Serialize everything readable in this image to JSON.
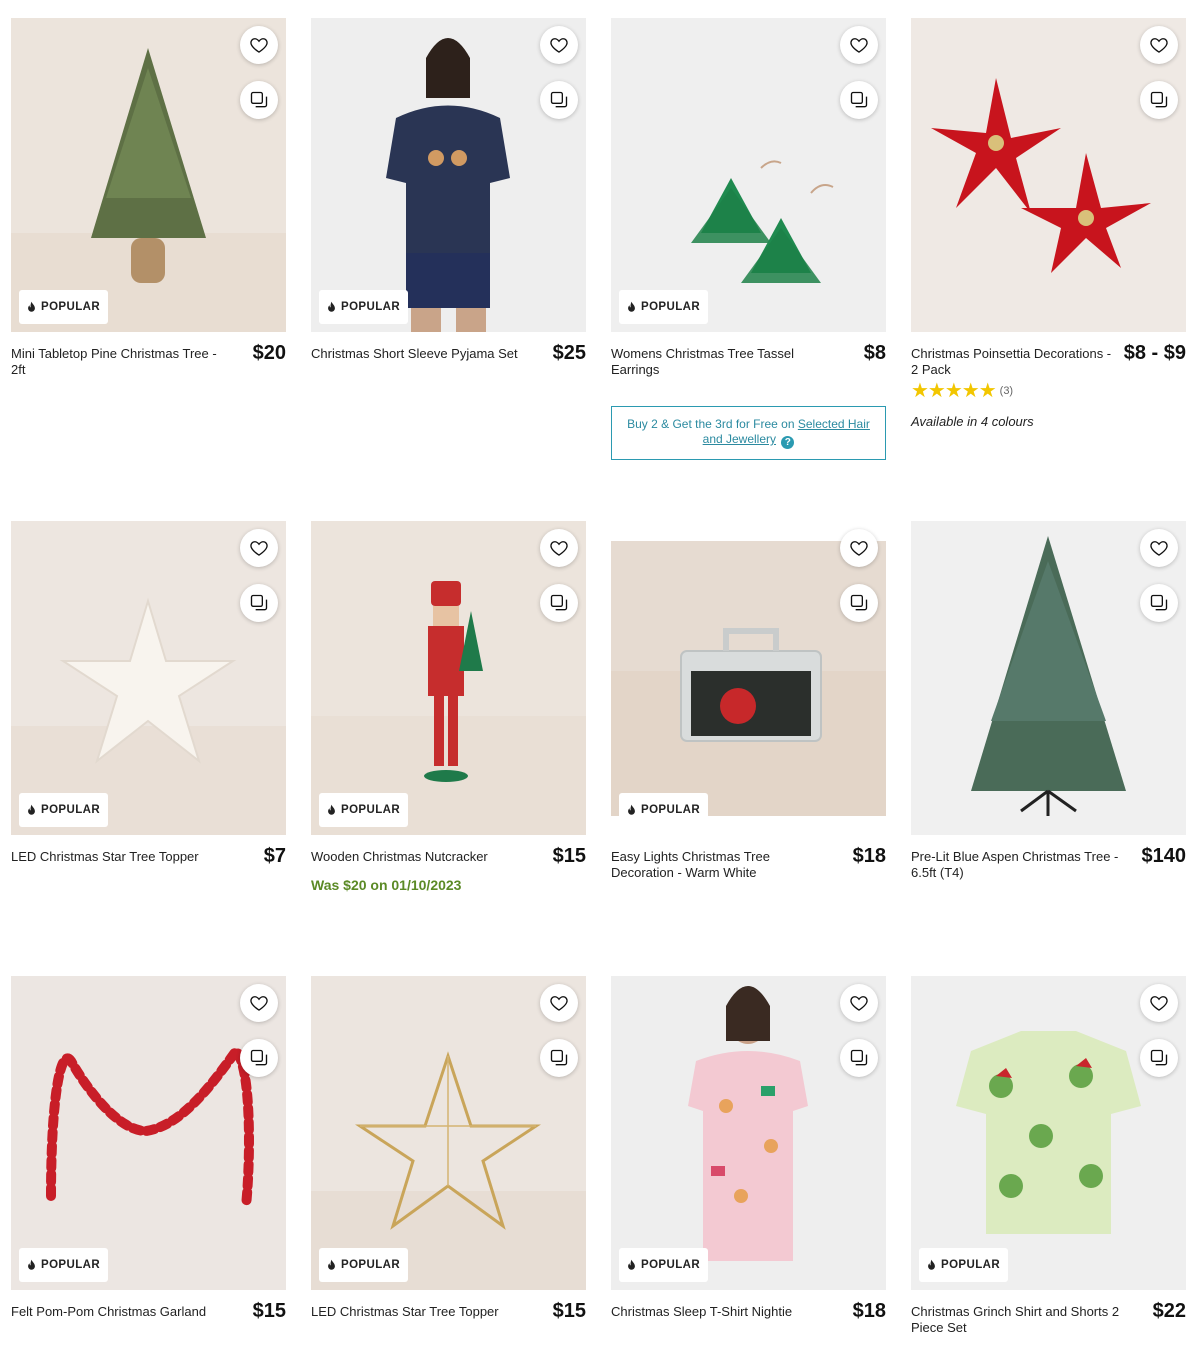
{
  "badge_label": "POPULAR",
  "products": [
    {
      "name": "Mini Tabletop Pine Christmas Tree - 2ft",
      "price": "$20",
      "badge": "POPULAR"
    },
    {
      "name": "Christmas Short Sleeve Pyjama Set",
      "price": "$25",
      "badge": "POPULAR"
    },
    {
      "name": "Womens Christmas Tree Tassel Earrings",
      "price": "$8",
      "badge": "POPULAR",
      "promo": {
        "text": "Buy 2 & Get the 3rd for Free on ",
        "link": "Selected Hair and Jewellery",
        "help_icon": "?"
      }
    },
    {
      "name": "Christmas Poinsettia Decorations - 2 Pack",
      "price": "$8 - $9",
      "rating": {
        "stars": "★★★★★",
        "count": "(3)",
        "value": 5
      },
      "availability": "Available in 4 colours"
    },
    {
      "name": "LED Christmas Star Tree Topper",
      "price": "$7",
      "badge": "POPULAR"
    },
    {
      "name": "Wooden Christmas Nutcracker",
      "price": "$15",
      "badge": "POPULAR",
      "was": "Was $20 on 01/10/2023"
    },
    {
      "name": "Easy Lights Christmas Tree Decoration - Warm White",
      "price": "$18",
      "badge": "POPULAR"
    },
    {
      "name": "Pre-Lit Blue Aspen Christmas Tree - 6.5ft (T4)",
      "price": "$140"
    },
    {
      "name": "Felt Pom-Pom Christmas Garland",
      "price": "$15",
      "badge": "POPULAR"
    },
    {
      "name": "LED Christmas Star Tree Topper",
      "price": "$15",
      "badge": "POPULAR"
    },
    {
      "name": "Christmas Sleep T-Shirt Nightie",
      "price": "$18",
      "badge": "POPULAR"
    },
    {
      "name": "Christmas Grinch Shirt and Shorts 2 Piece Set",
      "price": "$22",
      "badge": "POPULAR"
    }
  ],
  "icons": {
    "wishlist": "heart-icon",
    "compare": "compare-icon",
    "badge": "flame-icon"
  },
  "colors": {
    "promo_border": "#2b9ab1",
    "was_price": "#5b8a26",
    "star": "#f2c600"
  }
}
